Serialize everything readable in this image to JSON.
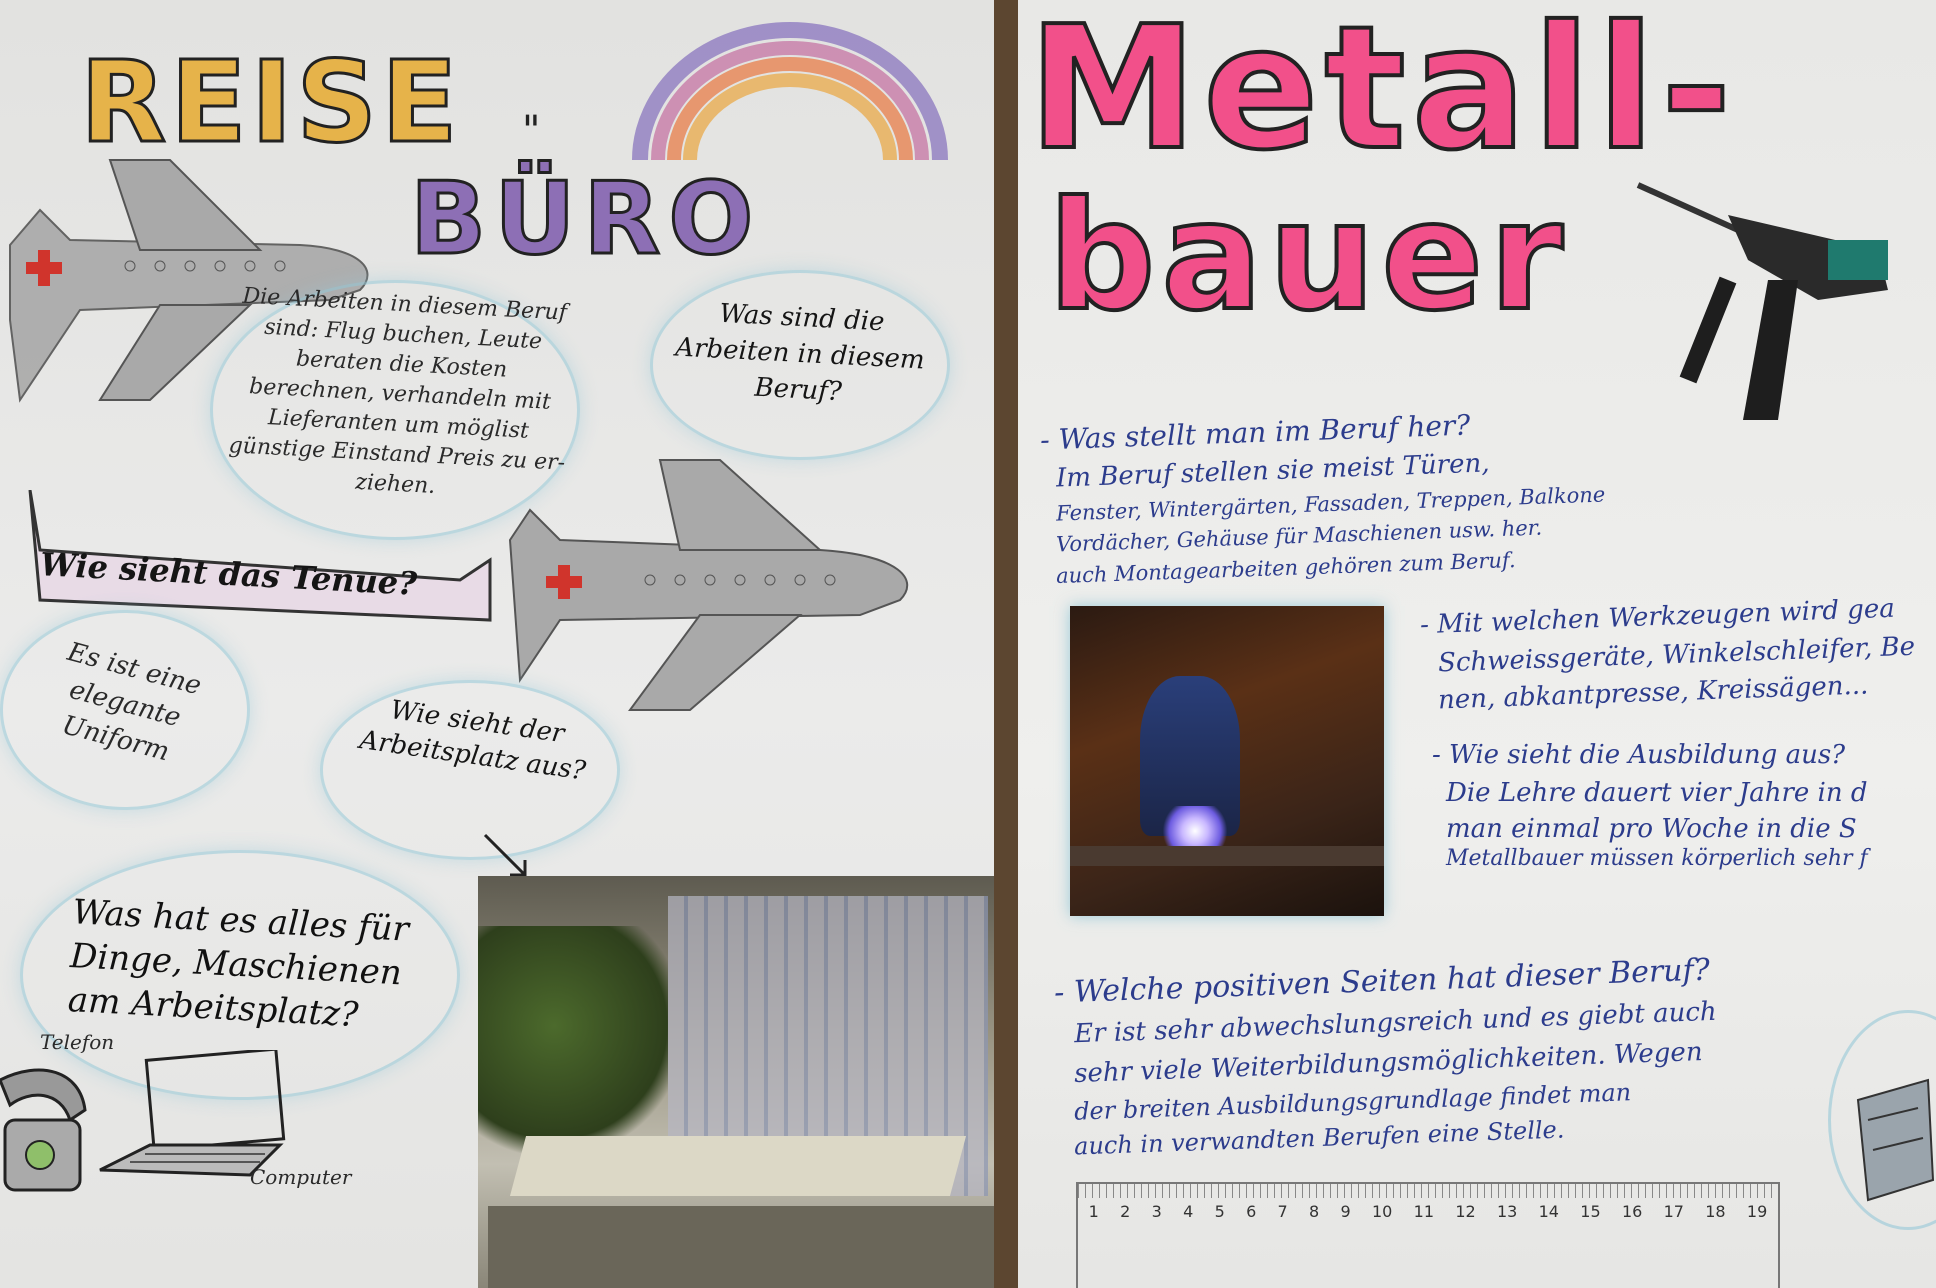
{
  "left_poster": {
    "title_word1": "REISE",
    "title_word2": "BÜRO",
    "cloud_task_question": "Was sind die Arbeiten in diesem Beruf?",
    "cloud_task_answer": "Die Arbeiten in diesem Beruf sind: Flug buchen, Leute beraten die Kosten berechnen, verhandeln mit Lieferanten um möglist günstige Einstand Preis zu er-ziehen.",
    "banner_question": "Wie sieht das Tenue?",
    "cloud_uniform": "Es ist eine elegante Uniform",
    "cloud_workplace": "Wie sieht der Arbeitsplatz aus?",
    "cloud_machines": "Was hat es alles für Dinge, Maschienen am Arbeitsplatz?",
    "label_phone": "Telefon",
    "label_computer": "Computer"
  },
  "right_poster": {
    "title_line1": "Metall-",
    "title_line2": "bauer",
    "q1": "- Was stellt man im Beruf her?",
    "a1_l1": "Im Beruf stellen sie meist Türen,",
    "a1_l2": "Fenster, Wintergärten, Fassaden, Treppen, Balkone",
    "a1_l3": "Vordächer, Gehäuse für Maschienen usw. her.",
    "a1_l4": "auch Montagearbeiten gehören zum Beruf.",
    "q2": "- Mit welchen Werkzeugen wird gea",
    "a2_l1": "Schweissgeräte, Winkelschleifer, Be",
    "a2_l2": "nen, abkantpresse, Kreissägen...",
    "q3": "- Wie sieht die Ausbildung aus?",
    "a3_l1": "Die Lehre dauert vier Jahre in d",
    "a3_l2": "man einmal pro Woche in die S",
    "a3_l3": "Metallbauer müssen körperlich sehr f",
    "q4": "- Welche positiven Seiten hat dieser Beruf?",
    "a4_l1": "Er ist sehr abwechslungsreich und es giebt auch",
    "a4_l2": "sehr viele Weiterbildungsmöglichkeiten. Wegen",
    "a4_l3": "der breiten Ausbildungsgrundlage findet man",
    "a4_l4": "auch in verwandten Berufen eine Stelle.",
    "ruler_numbers": [
      "1",
      "2",
      "3",
      "4",
      "5",
      "6",
      "7",
      "8",
      "9",
      "10",
      "11",
      "12",
      "13",
      "14",
      "15",
      "16",
      "17",
      "18",
      "19"
    ]
  },
  "colors": {
    "pink_marker": "#f2508a",
    "rainbow": [
      "#e9b05a",
      "#e88a5a",
      "#c77aa8",
      "#8f7cc0"
    ],
    "cloud_outline": "#9fcad6",
    "pen_blue": "#2c3c8c"
  }
}
